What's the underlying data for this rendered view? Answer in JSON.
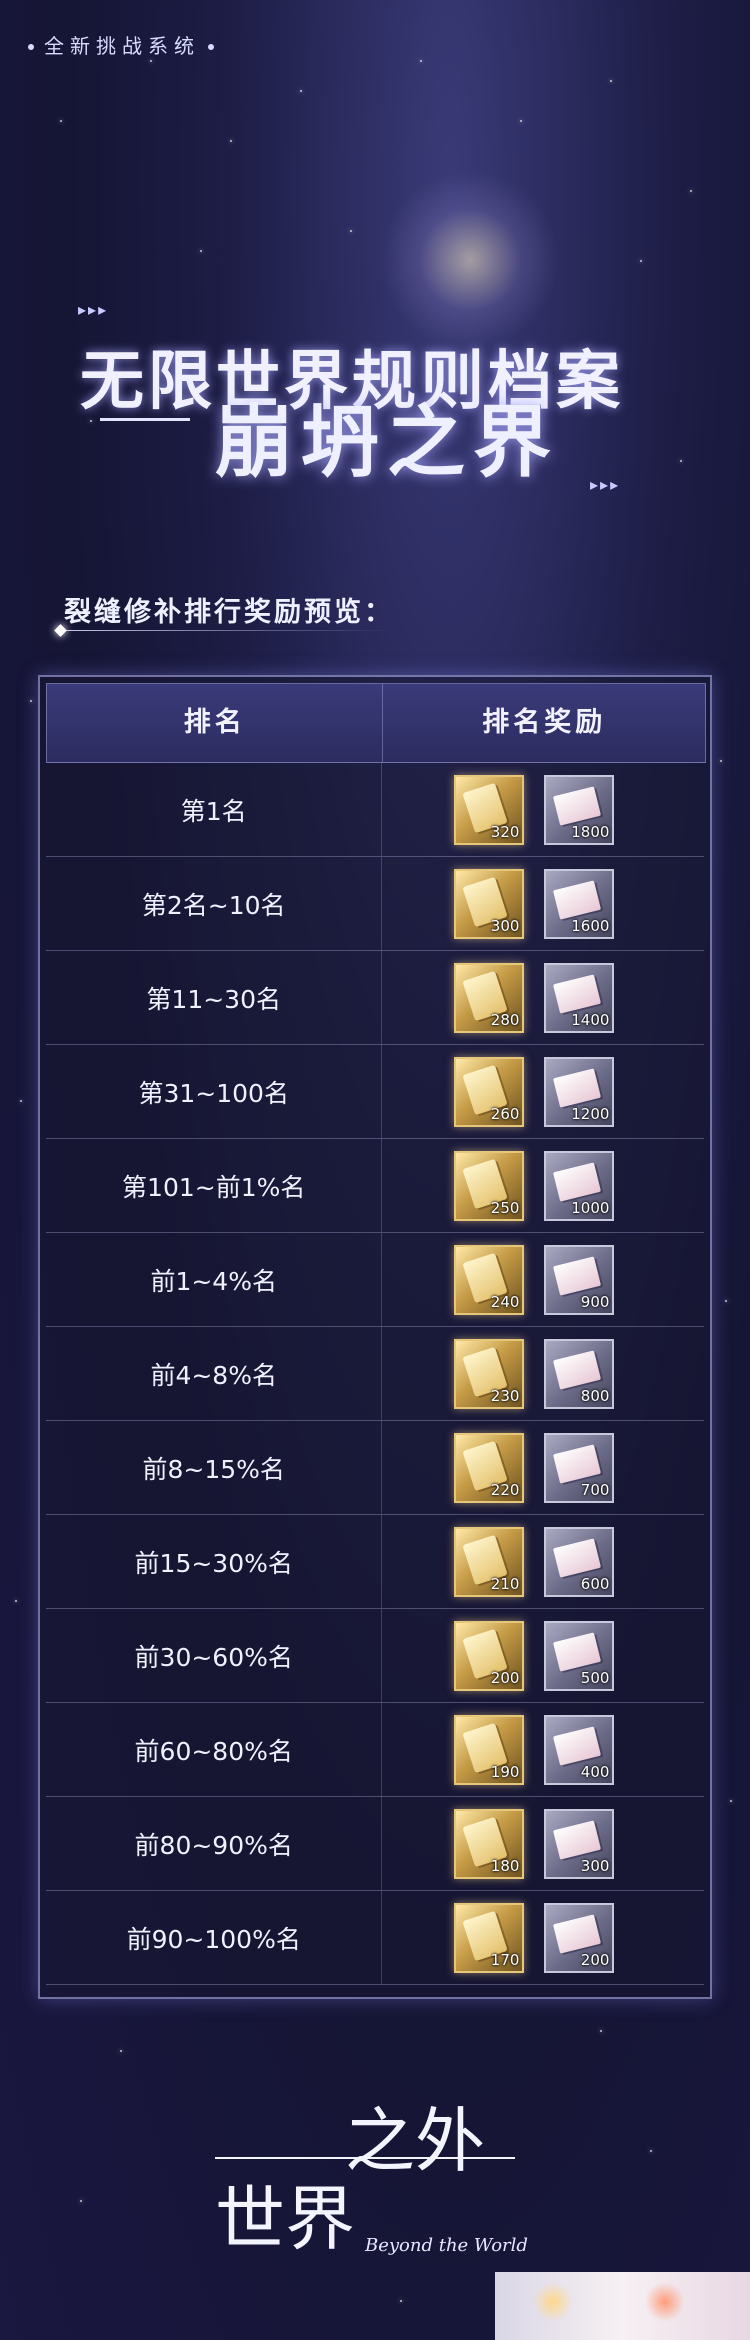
{
  "top_tag": "全新挑战系统",
  "title": {
    "main": "无限世界规则档案",
    "sub": "崩坍之界"
  },
  "section_label": "裂缝修补排行奖励预览：",
  "table": {
    "headers": {
      "rank": "排名",
      "reward": "排名奖励"
    },
    "rows": [
      {
        "rank": "第1名",
        "gold": "320",
        "silver": "1800"
      },
      {
        "rank": "第2名~10名",
        "gold": "300",
        "silver": "1600"
      },
      {
        "rank": "第11~30名",
        "gold": "280",
        "silver": "1400"
      },
      {
        "rank": "第31~100名",
        "gold": "260",
        "silver": "1200"
      },
      {
        "rank": "第101~前1%名",
        "gold": "250",
        "silver": "1000"
      },
      {
        "rank": "前1~4%名",
        "gold": "240",
        "silver": "900"
      },
      {
        "rank": "前4~8%名",
        "gold": "230",
        "silver": "800"
      },
      {
        "rank": "前8~15%名",
        "gold": "220",
        "silver": "700"
      },
      {
        "rank": "前15~30%名",
        "gold": "210",
        "silver": "600"
      },
      {
        "rank": "前30~60%名",
        "gold": "200",
        "silver": "500"
      },
      {
        "rank": "前60~80%名",
        "gold": "190",
        "silver": "400"
      },
      {
        "rank": "前80~90%名",
        "gold": "180",
        "silver": "300"
      },
      {
        "rank": "前90~100%名",
        "gold": "170",
        "silver": "200"
      }
    ]
  },
  "logo": {
    "chars_top": "之外",
    "chars_bottom": "世界",
    "script": "Beyond the World"
  }
}
